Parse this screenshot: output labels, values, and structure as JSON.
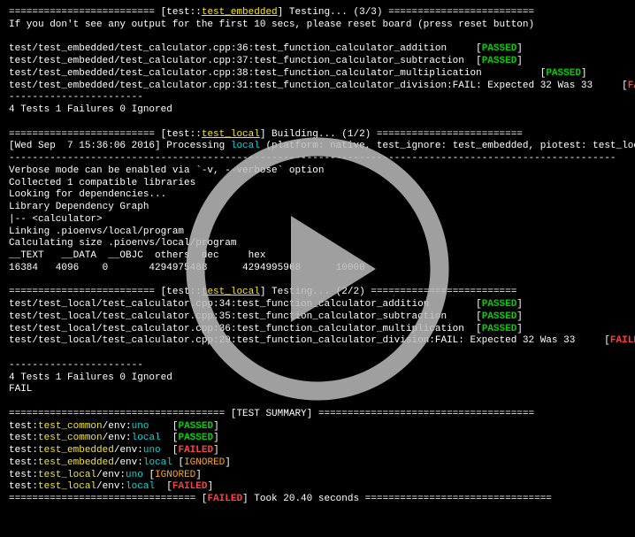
{
  "sec1": {
    "header_open": "========================= [test::",
    "header_name": "test_embedded",
    "header_rest": "] Testing... (3/3) =========================",
    "hint": "If you don't see any output for the first 10 secs, please reset board (press reset button)",
    "r1a": "test/test_embedded/test_calculator.cpp:36:test_function_calculator_addition     [",
    "r1b": "PASSED",
    "r1c": "]",
    "r2a": "test/test_embedded/test_calculator.cpp:37:test_function_calculator_subtraction  [",
    "r2b": "PASSED",
    "r2c": "]",
    "r3a": "test/test_embedded/test_calculator.cpp:38:test_function_calculator_multiplication          [",
    "r3b": "PASSED",
    "r3c": "]",
    "r4a": "test/test_embedded/test_calculator.cpp:31:test_function_calculator_division:FAIL: Expected 32 Was 33     [",
    "r4b": "FAILED",
    "r4c": "]",
    "dash": "-----------------------",
    "sum": "4 Tests 1 Failures 0 Ignored"
  },
  "sec2": {
    "header_open": "========================= [test::",
    "header_name": "test_local",
    "header_rest": "] Building... (1/2) =========================",
    "wa": "[Wed Sep  7 15:36:06 2016] Processing ",
    "wb": "local",
    "wc": " (platform: native, test_ignore: test_embedded, piotest: test_local)",
    "dash": "--------------------------------------------------------------------------------------------------------",
    "v1": "Verbose mode can be enabled via `-v, --verbose` option",
    "v2": "Collected 1 compatible libraries",
    "v3": "Looking for dependencies...",
    "v4": "Library Dependency Graph",
    "v5": "|-- <calculator>",
    "v6": "Linking .pioenvs/local/program",
    "v7": "Calculating size .pioenvs/local/program",
    "hd": "__TEXT   __DATA  __OBJC  others  dec     hex",
    "vl": "16384   4096    0       4294975488      4294995968      10000"
  },
  "sec3": {
    "header_open": "========================= [test::",
    "header_name": "test_local",
    "header_rest": "] Testing... (2/2) =========================",
    "r1a": "test/test_local/test_calculator.cpp:34:test_function_calculator_addition        [",
    "r1b": "PASSED",
    "r1c": "]",
    "r2a": "test/test_local/test_calculator.cpp:35:test_function_calculator_subtraction     [",
    "r2b": "PASSED",
    "r2c": "]",
    "r3a": "test/test_local/test_calculator.cpp:36:test_function_calculator_multiplication  [",
    "r3b": "PASSED",
    "r3c": "]",
    "r4a": "test/test_local/test_calculator.cpp:29:test_function_calculator_division:FAIL: Expected 32 Was 33     [",
    "r4b": "FAILED",
    "r4c": "]",
    "dash": "-----------------------",
    "sum": "4 Tests 1 Failures 0 Ignored",
    "fail": "FAIL"
  },
  "summary": {
    "header": "===================================== [TEST SUMMARY] =====================================",
    "l1a": "test:",
    "l1b": "test_common",
    "l1c": "/env:",
    "l1d": "uno",
    "l1e": "    [",
    "l1f": "PASSED",
    "l1g": "]",
    "l2a": "test:",
    "l2b": "test_common",
    "l2c": "/env:",
    "l2d": "local",
    "l2e": "  [",
    "l2f": "PASSED",
    "l2g": "]",
    "l3a": "test:",
    "l3b": "test_embedded",
    "l3c": "/env:",
    "l3d": "uno",
    "l3e": "  [",
    "l3f": "FAILED",
    "l3g": "]",
    "l4a": "test:",
    "l4b": "test_embedded",
    "l4c": "/env:",
    "l4d": "local",
    "l4e": " [",
    "l4f": "IGNORED",
    "l4g": "]",
    "l5a": "test:",
    "l5b": "test_local",
    "l5c": "/env:",
    "l5d": "uno",
    "l5e": " [",
    "l5f": "IGNORED",
    "l5g": "]",
    "l6a": "test:",
    "l6b": "test_local",
    "l6c": "/env:",
    "l6d": "local",
    "l6e": "  [",
    "l6f": "FAILED",
    "l6g": "]",
    "f1": "================================ [",
    "f2": "FAILED",
    "f3": "] Took 20.40 seconds ================================"
  }
}
